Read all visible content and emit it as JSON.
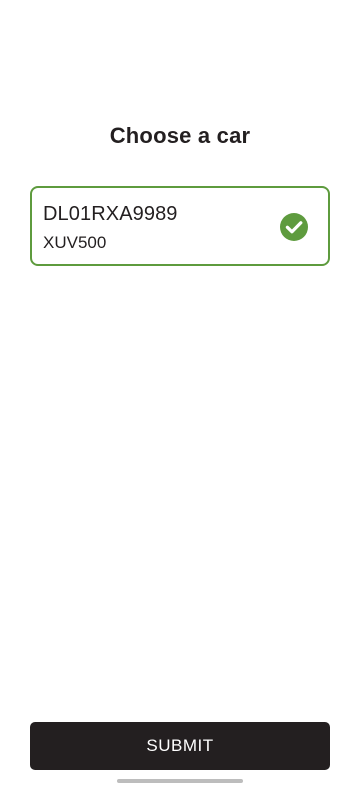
{
  "page": {
    "title": "Choose a car"
  },
  "cars": [
    {
      "plate": "DL01RXA9989",
      "model": "XUV500",
      "selected": true,
      "icon": "check-circle-icon"
    }
  ],
  "actions": {
    "submit_label": "SUBMIT"
  },
  "colors": {
    "accent": "#5e9b3e",
    "text": "#231f20",
    "button_bg": "#231f20",
    "button_text": "#ffffff",
    "home_indicator": "#bdbdbd"
  }
}
